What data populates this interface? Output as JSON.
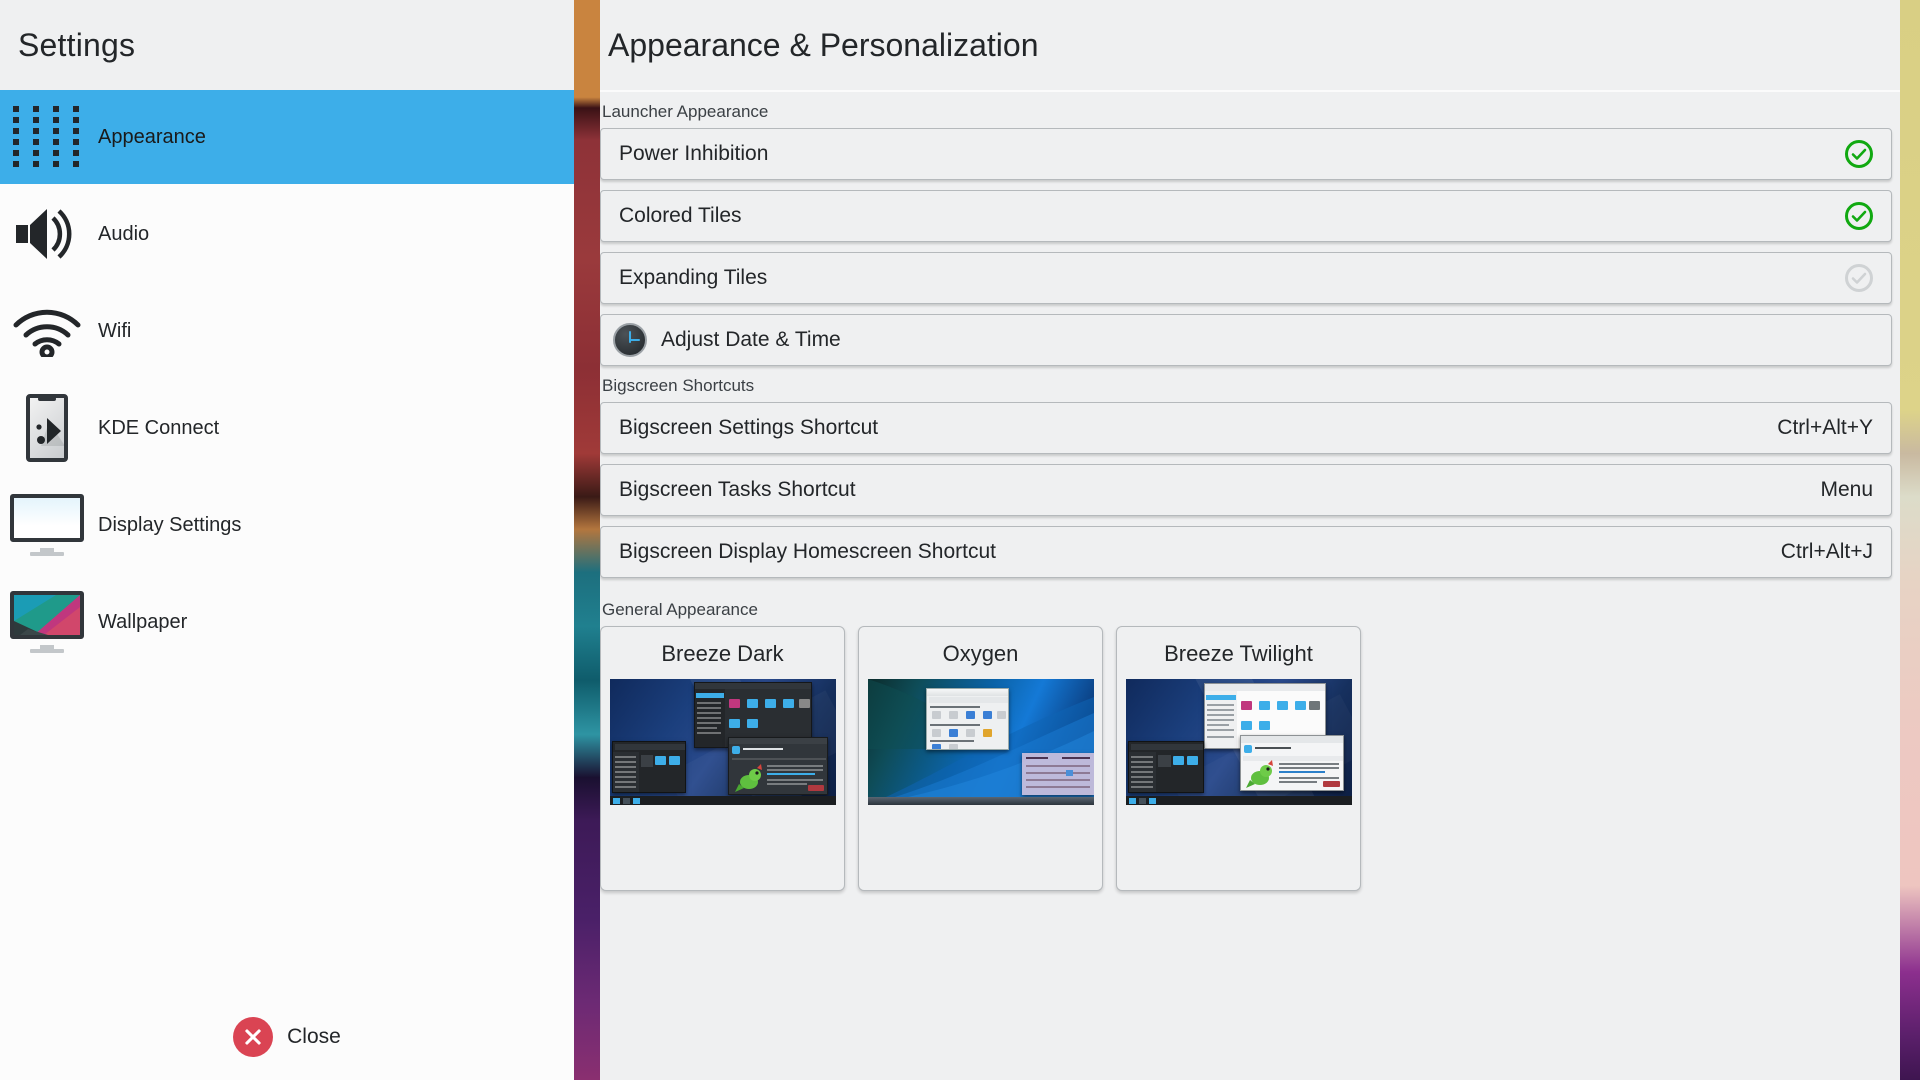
{
  "sidebar": {
    "title": "Settings",
    "items": [
      {
        "label": "Appearance",
        "icon": "dot-grid-icon",
        "selected": true
      },
      {
        "label": "Audio",
        "icon": "speaker-icon",
        "selected": false
      },
      {
        "label": "Wifi",
        "icon": "wifi-icon",
        "selected": false
      },
      {
        "label": "KDE Connect",
        "icon": "phone-connect-icon",
        "selected": false
      },
      {
        "label": "Display Settings",
        "icon": "monitor-icon",
        "selected": false
      },
      {
        "label": "Wallpaper",
        "icon": "monitor-wallpaper-icon",
        "selected": false
      }
    ],
    "close_label": "Close",
    "close_icon": "close-circle-icon"
  },
  "main": {
    "title": "Appearance & Personalization",
    "sections": {
      "launcher": {
        "label": "Launcher Appearance",
        "toggles": [
          {
            "label": "Power Inhibition",
            "checked": true,
            "icon": "check-circle-icon"
          },
          {
            "label": "Colored Tiles",
            "checked": true,
            "icon": "check-circle-icon"
          },
          {
            "label": "Expanding Tiles",
            "checked": false,
            "icon": "check-circle-icon"
          }
        ],
        "action": {
          "label": "Adjust Date & Time",
          "icon": "clock-icon"
        }
      },
      "shortcuts": {
        "label": "Bigscreen Shortcuts",
        "items": [
          {
            "label": "Bigscreen Settings Shortcut",
            "value": "Ctrl+Alt+Y"
          },
          {
            "label": "Bigscreen Tasks Shortcut",
            "value": "Menu"
          },
          {
            "label": "Bigscreen Display Homescreen Shortcut",
            "value": "Ctrl+Alt+J"
          }
        ]
      },
      "general": {
        "label": "General Appearance",
        "themes": [
          {
            "name": "Breeze Dark",
            "thumb": "breeze-dark-preview"
          },
          {
            "name": "Oxygen",
            "thumb": "oxygen-preview"
          },
          {
            "name": "Breeze Twilight",
            "thumb": "breeze-twilight-preview"
          }
        ]
      }
    }
  },
  "colors": {
    "accent": "#3daee9",
    "panel_bg": "#eff0f1",
    "sidebar_bg": "#fcfcfc",
    "check_on": "#11a911",
    "check_off": "#cfd2d4",
    "close_red": "#da4453",
    "text": "#232629"
  }
}
